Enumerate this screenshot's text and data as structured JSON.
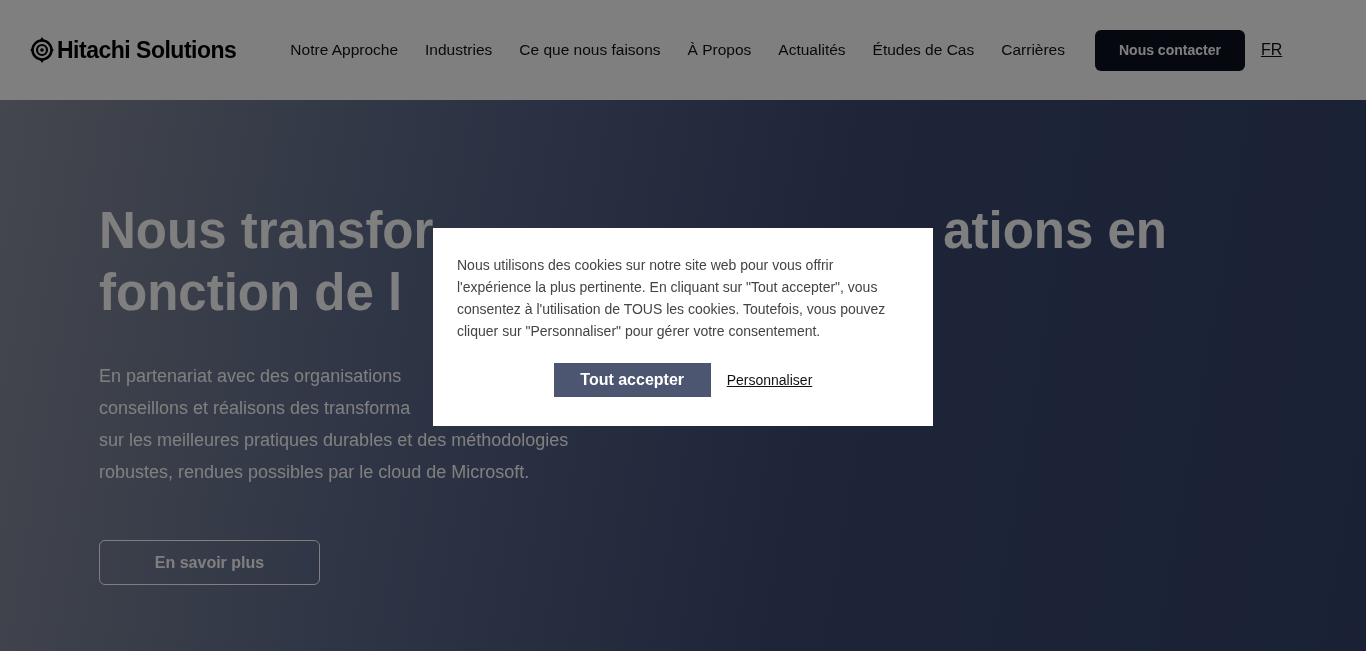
{
  "header": {
    "logo": "Hitachi Solutions",
    "nav": [
      {
        "label": "Notre Approche"
      },
      {
        "label": "Industries"
      },
      {
        "label": "Ce que nous faisons"
      },
      {
        "label": "À Propos"
      },
      {
        "label": "Actualités"
      },
      {
        "label": "Études de Cas"
      },
      {
        "label": "Carrières"
      }
    ],
    "contact_button": "Nous contacter",
    "language": "FR"
  },
  "hero": {
    "heading_line_1_left": "Nous transfor",
    "heading_line_1_right": "ations en",
    "heading_line_2": "fonction de l",
    "paragraph_lines": [
      "En partenariat avec des organisations",
      "conseillons et réalisons des transforma",
      "sur les meilleures pratiques durables et des méthodologies",
      "robustes, rendues possibles par le cloud de Microsoft."
    ],
    "button": "En savoir plus"
  },
  "cookie_banner": {
    "message": "Nous utilisons des cookies sur notre site web pour vous offrir l'expérience la plus pertinente. En cliquant sur \"Tout accepter\", vous consentez à l'utilisation de TOUS les cookies. Toutefois, vous pouvez cliquer sur \"Personnaliser\" pour gérer votre consentement.",
    "accept_button": "Tout accepter",
    "customize_link": "Personnaliser"
  }
}
